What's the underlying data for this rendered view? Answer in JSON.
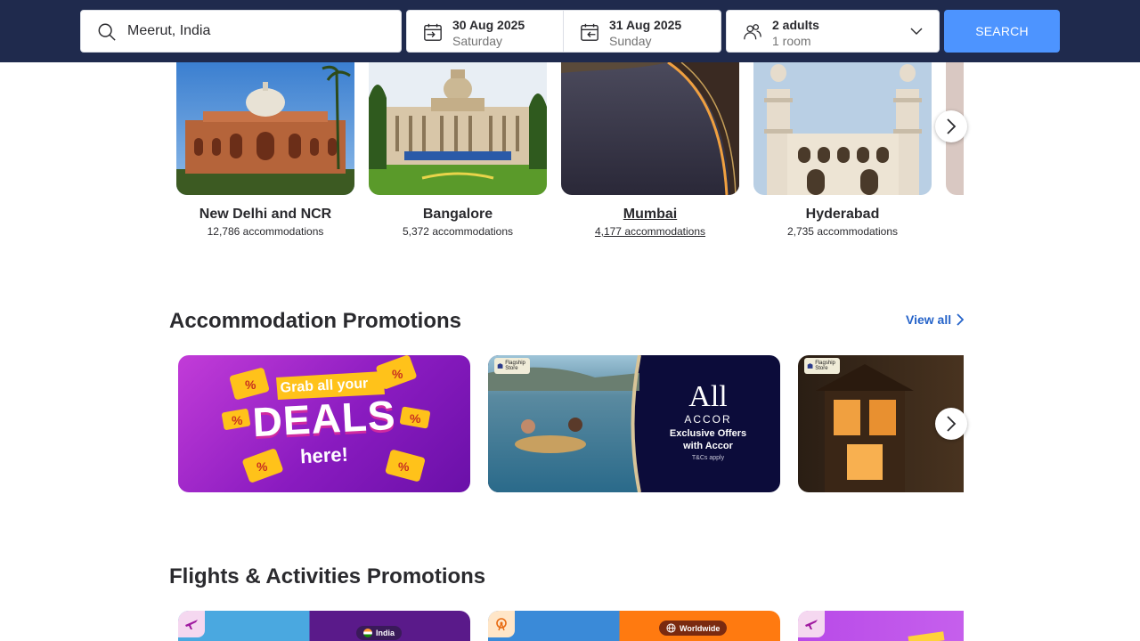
{
  "search": {
    "destination": "Meerut, India",
    "checkin_date": "30 Aug 2025",
    "checkin_day": "Saturday",
    "checkout_date": "31 Aug 2025",
    "checkout_day": "Sunday",
    "guests": "2 adults",
    "rooms": "1 room",
    "button_label": "SEARCH"
  },
  "cities": [
    {
      "name": "New Delhi and NCR",
      "count": "12,786 accommodations"
    },
    {
      "name": "Bangalore",
      "count": "5,372 accommodations"
    },
    {
      "name": "Mumbai",
      "count": "4,177 accommodations"
    },
    {
      "name": "Hyderabad",
      "count": "2,735 accommodations"
    }
  ],
  "accommodation_promos": {
    "title": "Accommodation Promotions",
    "view_all": "View all",
    "deals": {
      "line1": "Grab all your",
      "line2": "DEALS",
      "line3": "here!"
    },
    "accor": {
      "logo": "All",
      "brand": "ACCOR",
      "text1": "Exclusive Offers",
      "text2": "with Accor",
      "terms": "T&Cs apply",
      "store_tag": "Flagship Store"
    },
    "third": {
      "store_tag": "Flagship Store"
    }
  },
  "flights_promos": {
    "title": "Flights & Activities Promotions",
    "badges": [
      "India",
      "Worldwide"
    ]
  },
  "colors": {
    "header_bg": "#1f2a4d",
    "search_button": "#4d94ff",
    "link_blue": "#2563c9"
  }
}
